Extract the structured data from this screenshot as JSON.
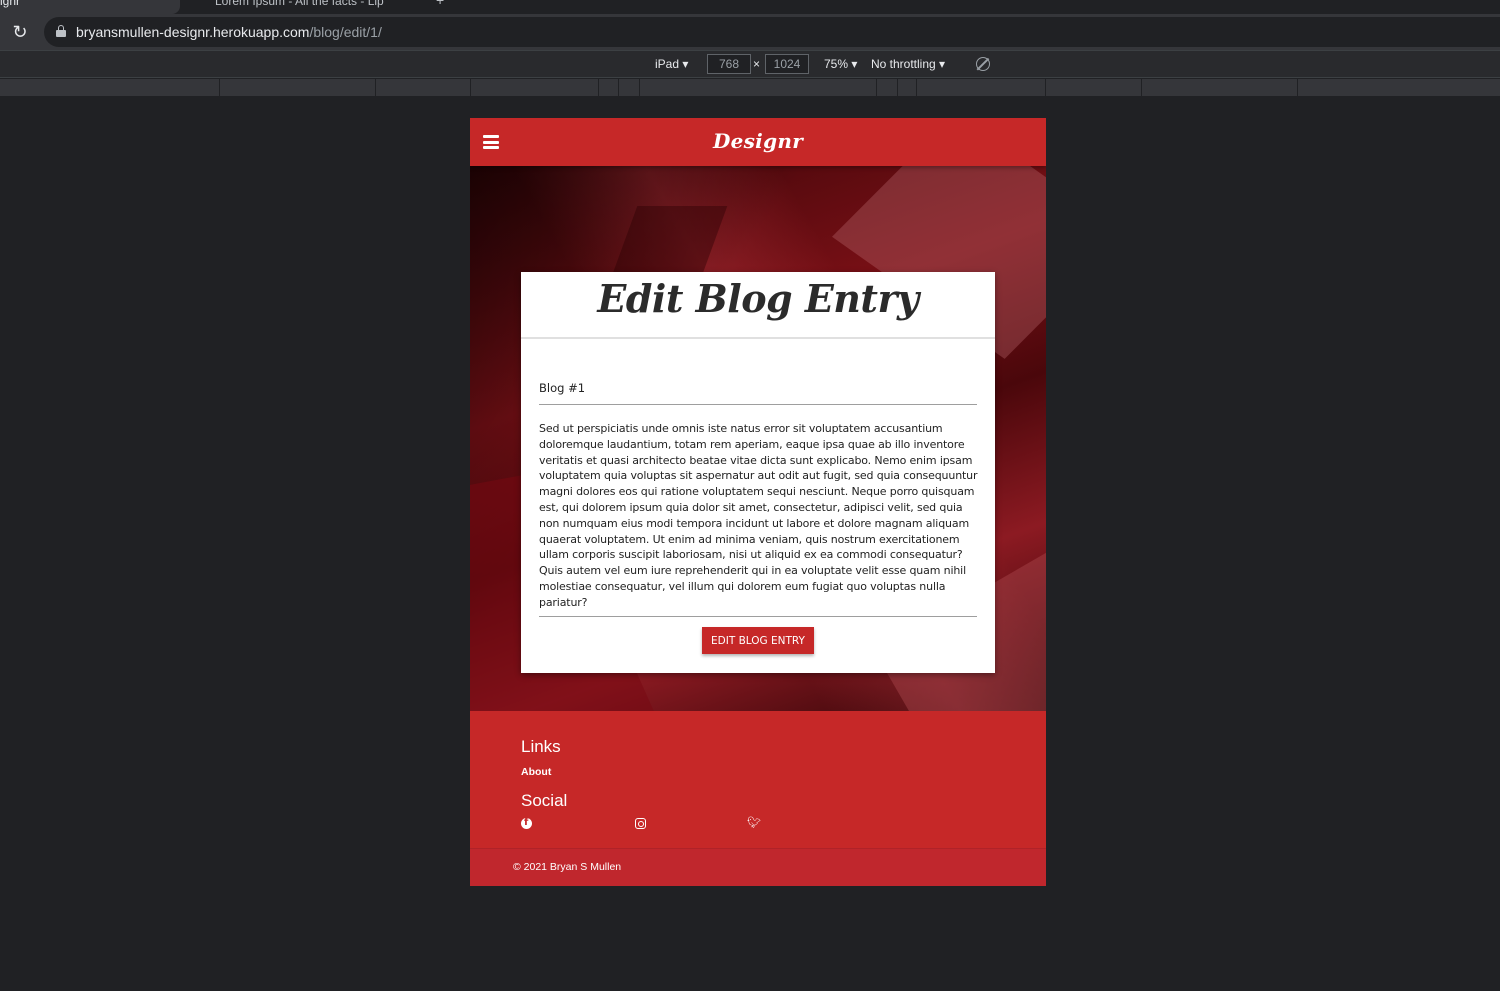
{
  "browser": {
    "tabs": [
      {
        "label": "ignr",
        "close": "×"
      },
      {
        "label": "Lorem Ipsum - All the facts - Lip",
        "close": "×"
      }
    ],
    "new_tab": "+",
    "url_host": "bryansmullen-designr.herokuapp.com",
    "url_path": "/blog/edit/1/"
  },
  "devtools": {
    "device": "iPad ▾",
    "width": "768",
    "times": "×",
    "height": "1024",
    "zoom": "75% ▾",
    "throttling": "No throttling ▾"
  },
  "site": {
    "brand": "Designr",
    "page_title": "Edit Blog Entry",
    "form": {
      "title_value": "Blog #1",
      "body_value": "Sed ut perspiciatis unde omnis iste natus error sit voluptatem accusantium doloremque laudantium, totam rem aperiam, eaque ipsa quae ab illo inventore veritatis et quasi architecto beatae vitae dicta sunt explicabo. Nemo enim ipsam voluptatem quia voluptas sit aspernatur aut odit aut fugit, sed quia consequuntur magni dolores eos qui ratione voluptatem sequi nesciunt. Neque porro quisquam est, qui dolorem ipsum quia dolor sit amet, consectetur, adipisci velit, sed quia non numquam eius modi tempora incidunt ut labore et dolore magnam aliquam quaerat voluptatem. Ut enim ad minima veniam, quis nostrum exercitationem ullam corporis suscipit laboriosam, nisi ut aliquid ex ea commodi consequatur? Quis autem vel eum iure reprehenderit qui in ea voluptate velit esse quam nihil molestiae consequatur, vel illum qui dolorem eum fugiat quo voluptas nulla pariatur?",
      "submit_label": "Edit Blog Entry"
    },
    "footer": {
      "links_heading": "Links",
      "links": [
        "About"
      ],
      "social_heading": "Social",
      "social_icons": [
        "facebook-icon",
        "instagram-icon",
        "twitter-icon"
      ],
      "copyright": "© 2021 Bryan S Mullen"
    },
    "colors": {
      "primary": "#c62828",
      "card": "#ffffff",
      "page_bg": "#202124"
    }
  }
}
